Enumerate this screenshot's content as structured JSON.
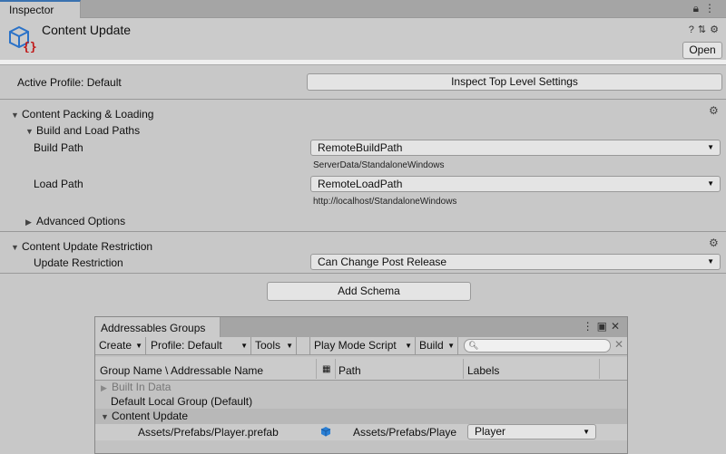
{
  "window": {
    "tab_label": "Inspector"
  },
  "header": {
    "title": "Content Update",
    "open_label": "Open"
  },
  "profile": {
    "active_label": "Active Profile: Default",
    "inspect_button": "Inspect Top Level Settings"
  },
  "packing": {
    "section_title": "Content Packing & Loading",
    "subsection_title": "Build and Load Paths",
    "build_path_label": "Build Path",
    "build_path_value": "RemoteBuildPath",
    "build_path_resolved": "ServerData/StandaloneWindows",
    "load_path_label": "Load Path",
    "load_path_value": "RemoteLoadPath",
    "load_path_resolved": "http://localhost/StandaloneWindows",
    "advanced_label": "Advanced Options"
  },
  "restriction": {
    "section_title": "Content Update Restriction",
    "update_label": "Update Restriction",
    "update_value": "Can Change Post Release"
  },
  "add_schema_label": "Add Schema",
  "groups_window": {
    "tab_label": "Addressables Groups",
    "toolbar": {
      "create": "Create",
      "profile": "Profile: Default",
      "tools": "Tools",
      "play_mode": "Play Mode Script",
      "build": "Build"
    },
    "columns": {
      "name": "Group Name \\ Addressable Name",
      "path": "Path",
      "labels": "Labels"
    },
    "rows": [
      {
        "name": "Built In Data"
      },
      {
        "name": "Default Local Group (Default)"
      },
      {
        "name": "Content Update"
      }
    ],
    "entry": {
      "name": "Assets/Prefabs/Player.prefab",
      "path": "Assets/Prefabs/Playe",
      "label": "Player"
    }
  },
  "colors": {
    "accent": "#3a72b0",
    "selected_row": "#b8b8b8"
  }
}
